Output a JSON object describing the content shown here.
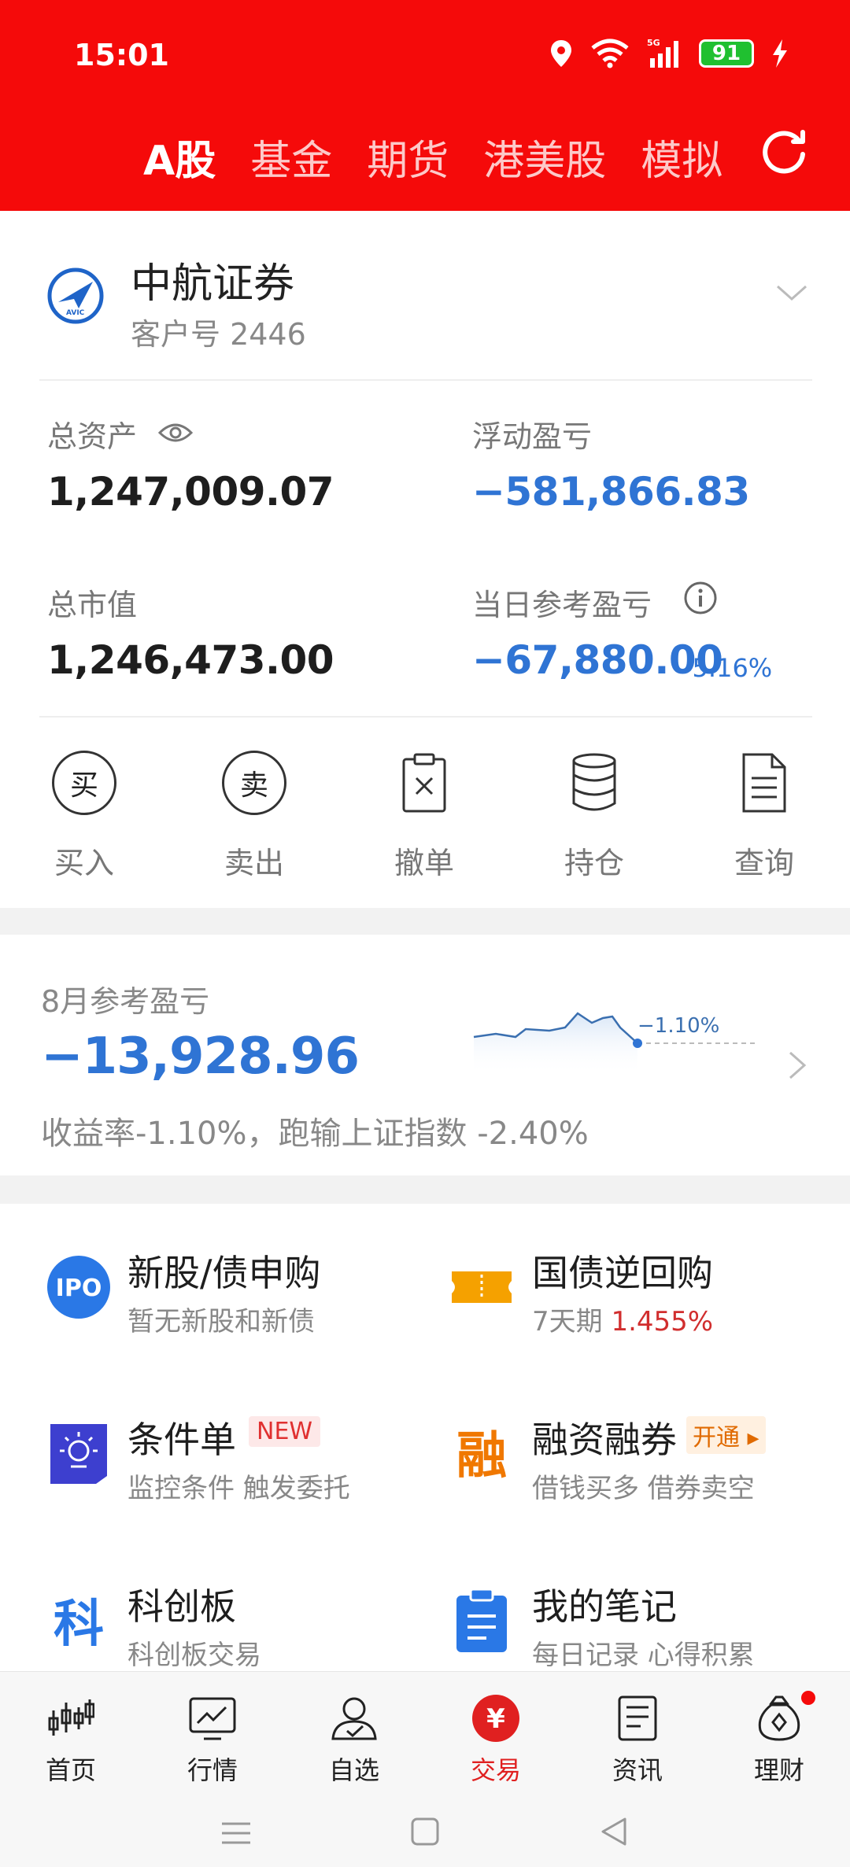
{
  "status": {
    "time": "15:01",
    "network": "5G",
    "battery": "91"
  },
  "tabs": [
    {
      "label": "A股",
      "active": true
    },
    {
      "label": "基金",
      "active": false
    },
    {
      "label": "期货",
      "active": false
    },
    {
      "label": "港美股",
      "active": false
    },
    {
      "label": "模拟",
      "active": false
    }
  ],
  "account": {
    "broker": "中航证券",
    "client_no": "客户号 2446",
    "total_assets_label": "总资产",
    "total_assets": "1,247,009.07",
    "float_pl_label": "浮动盈亏",
    "float_pl": "−581,866.83",
    "market_value_label": "总市值",
    "market_value": "1,246,473.00",
    "daily_pl_label": "当日参考盈亏",
    "daily_pl": "−67,880.00",
    "daily_pl_pct": "-5.16%"
  },
  "actions": [
    {
      "label": "买入",
      "glyph": "买"
    },
    {
      "label": "卖出",
      "glyph": "卖"
    },
    {
      "label": "撤单"
    },
    {
      "label": "持仓"
    },
    {
      "label": "查询"
    }
  ],
  "monthly": {
    "label": "8月参考盈亏",
    "value": "−13,928.96",
    "rate_text": "收益率-1.10%，跑输上证指数 -2.40%",
    "chart_end_label": "−1.10%"
  },
  "services": [
    {
      "title": "新股/债申购",
      "sub": "暂无新股和新债",
      "icon_text": "IPO"
    },
    {
      "title": "国债逆回购",
      "sub_prefix": "7天期 ",
      "sub_rate": "1.455%"
    },
    {
      "title": "条件单",
      "sub": "监控条件 触发委托",
      "badge": "NEW"
    },
    {
      "title": "融资融券",
      "sub": "借钱买多 借券卖空",
      "badge": "开通",
      "icon_text": "融"
    },
    {
      "title": "科创板",
      "sub": "科创板交易",
      "icon_text": "科"
    },
    {
      "title": "我的笔记",
      "sub": "每日记录 心得积累"
    }
  ],
  "nav": [
    {
      "label": "首页"
    },
    {
      "label": "行情"
    },
    {
      "label": "自选"
    },
    {
      "label": "交易",
      "active": true,
      "glyph": "¥"
    },
    {
      "label": "资讯"
    },
    {
      "label": "理财"
    }
  ],
  "colors": {
    "header_red": "#f50a0a",
    "loss_blue": "#2f74d4",
    "gain_red": "#d12e2e"
  }
}
